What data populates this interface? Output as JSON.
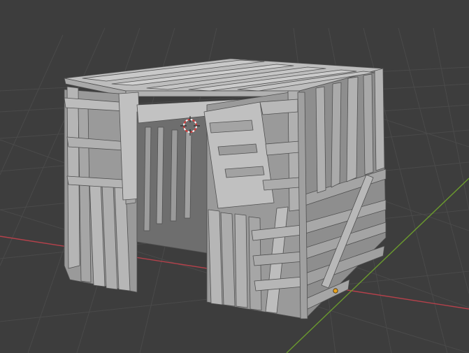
{
  "viewport": {
    "mode": "3d-viewport",
    "background_color": "#3d3d3d",
    "grid_color": "#4a4a4a",
    "x_axis_color": "#b5414b",
    "y_axis_color": "#6b9a2e"
  },
  "scene": {
    "object": "wooden-shack-mesh",
    "mesh_color": "#9e9e9e",
    "mesh_light_color": "#b7b7b7",
    "mesh_dark_color": "#808080",
    "edge_color": "#505050",
    "origin_color": "#e8a21c",
    "cursor_icon": "3d-cursor-icon"
  }
}
